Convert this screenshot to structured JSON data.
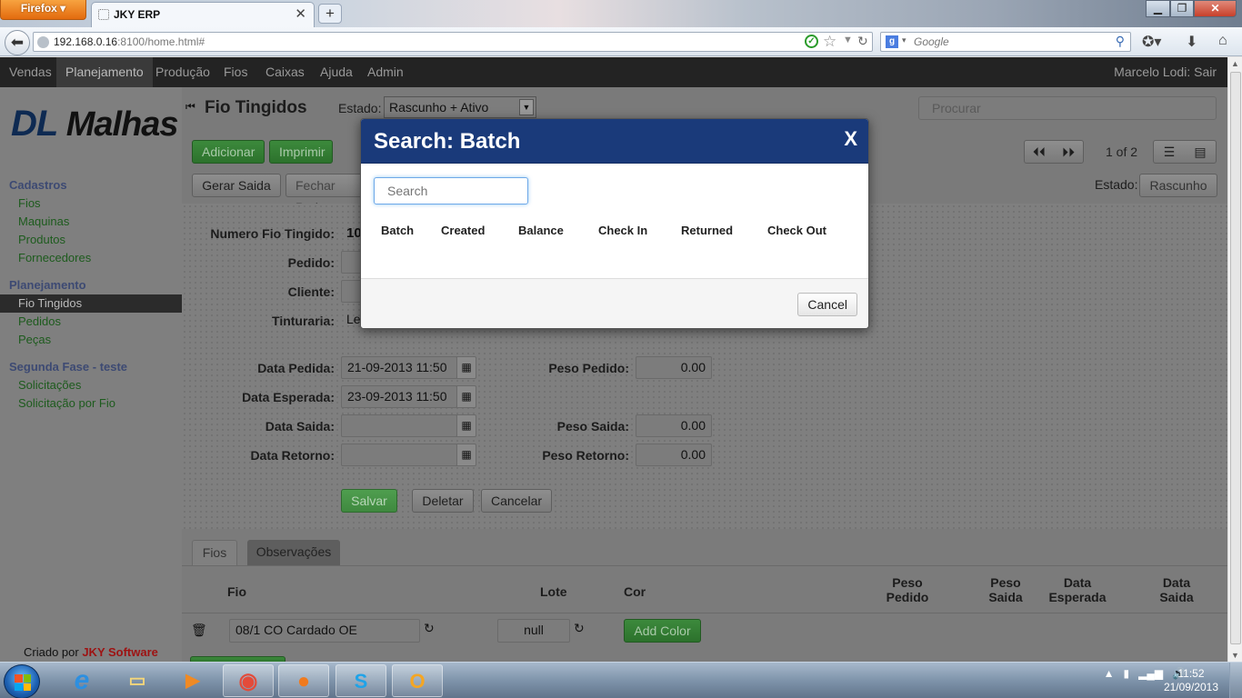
{
  "browser": {
    "menu_button": "Firefox",
    "tab_title": "JKY ERP",
    "new_tab": "+",
    "url_host": "192.168.0.16",
    "url_rest": ":8100/home.html#",
    "search_engine_placeholder": "Google",
    "window_min": "▁",
    "window_max": "❐",
    "window_close": "✕"
  },
  "app_nav": {
    "items": [
      "Vendas",
      "Planejamento",
      "Produção",
      "Fios",
      "Caixas",
      "Ajuda",
      "Admin"
    ],
    "active": "Planejamento",
    "user": "Marcelo Lodi:  Sair"
  },
  "sidebar": {
    "logo_dl": "DL",
    "logo_malhas": "Malhas",
    "sections": [
      {
        "title": "Cadastros",
        "items": [
          "Fios",
          "Maquinas",
          "Produtos",
          "Fornecedores"
        ]
      },
      {
        "title": "Planejamento",
        "items": [
          "Fio Tingidos",
          "Pedidos",
          "Peças"
        ]
      },
      {
        "title": "Segunda Fase - teste",
        "items": [
          "Solicitações",
          "Solicitação por Fio"
        ]
      }
    ],
    "active_item": "Fio Tingidos",
    "credit_prefix": "Criado por",
    "credit_company": "JKY Software"
  },
  "page": {
    "title": "Fio Tingidos",
    "estado_label": "Estado:",
    "estado_select": "Rascunho + Ativo",
    "search_placeholder": "Procurar",
    "add_button": "Adicionar",
    "print_button": "Imprimir",
    "pager": "1 of 2",
    "action_gerar": "Gerar Saida",
    "action_fechar": "Fechar Ped",
    "status_label": "Estado:",
    "status_value": "Rascunho"
  },
  "form": {
    "numero_label": "Numero Fio Tingido:",
    "numero_value": "10",
    "pedido_label": "Pedido:",
    "cliente_label": "Cliente:",
    "tinturaria_label": "Tinturaria:",
    "tinturaria_value": "Le",
    "data_pedida_label": "Data Pedida:",
    "data_pedida_value": "21-09-2013 11:50",
    "data_esperada_label": "Data Esperada:",
    "data_esperada_value": "23-09-2013 11:50",
    "data_saida_label": "Data Saida:",
    "data_retorno_label": "Data Retorno:",
    "peso_pedido_label": "Peso Pedido:",
    "peso_pedido_value": "0.00",
    "peso_saida_label": "Peso Saida:",
    "peso_saida_value": "0.00",
    "peso_retorno_label": "Peso Retorno:",
    "peso_retorno_value": "0.00",
    "save_button": "Salvar",
    "delete_button": "Deletar",
    "cancel_button": "Cancelar"
  },
  "detail_tabs": [
    "Fios",
    "Observações"
  ],
  "detail_table": {
    "headers": {
      "fio": "Fio",
      "lote": "Lote",
      "cor": "Cor",
      "peso_pedido_1": "Peso",
      "peso_pedido_2": "Pedido",
      "peso_saida_1": "Peso",
      "peso_saida_2": "Saida",
      "data_esperada_1": "Data",
      "data_esperada_2": "Esperada",
      "data_saida_1": "Data",
      "data_saida_2": "Saida"
    },
    "row": {
      "fio": "08/1 CO Cardado OE",
      "lote": "null",
      "add_color": "Add Color"
    }
  },
  "modal": {
    "title": "Search: Batch",
    "close": "X",
    "search_placeholder": "Search",
    "columns": [
      "Batch",
      "Created",
      "Balance",
      "Check In",
      "Returned",
      "Check Out"
    ],
    "cancel": "Cancel"
  },
  "taskbar": {
    "time": "11:52",
    "date": "21/09/2013"
  },
  "colors": {
    "modal_header": "#1a3a7a",
    "app_nav": "#232323",
    "primary_green": "#2c722c"
  }
}
